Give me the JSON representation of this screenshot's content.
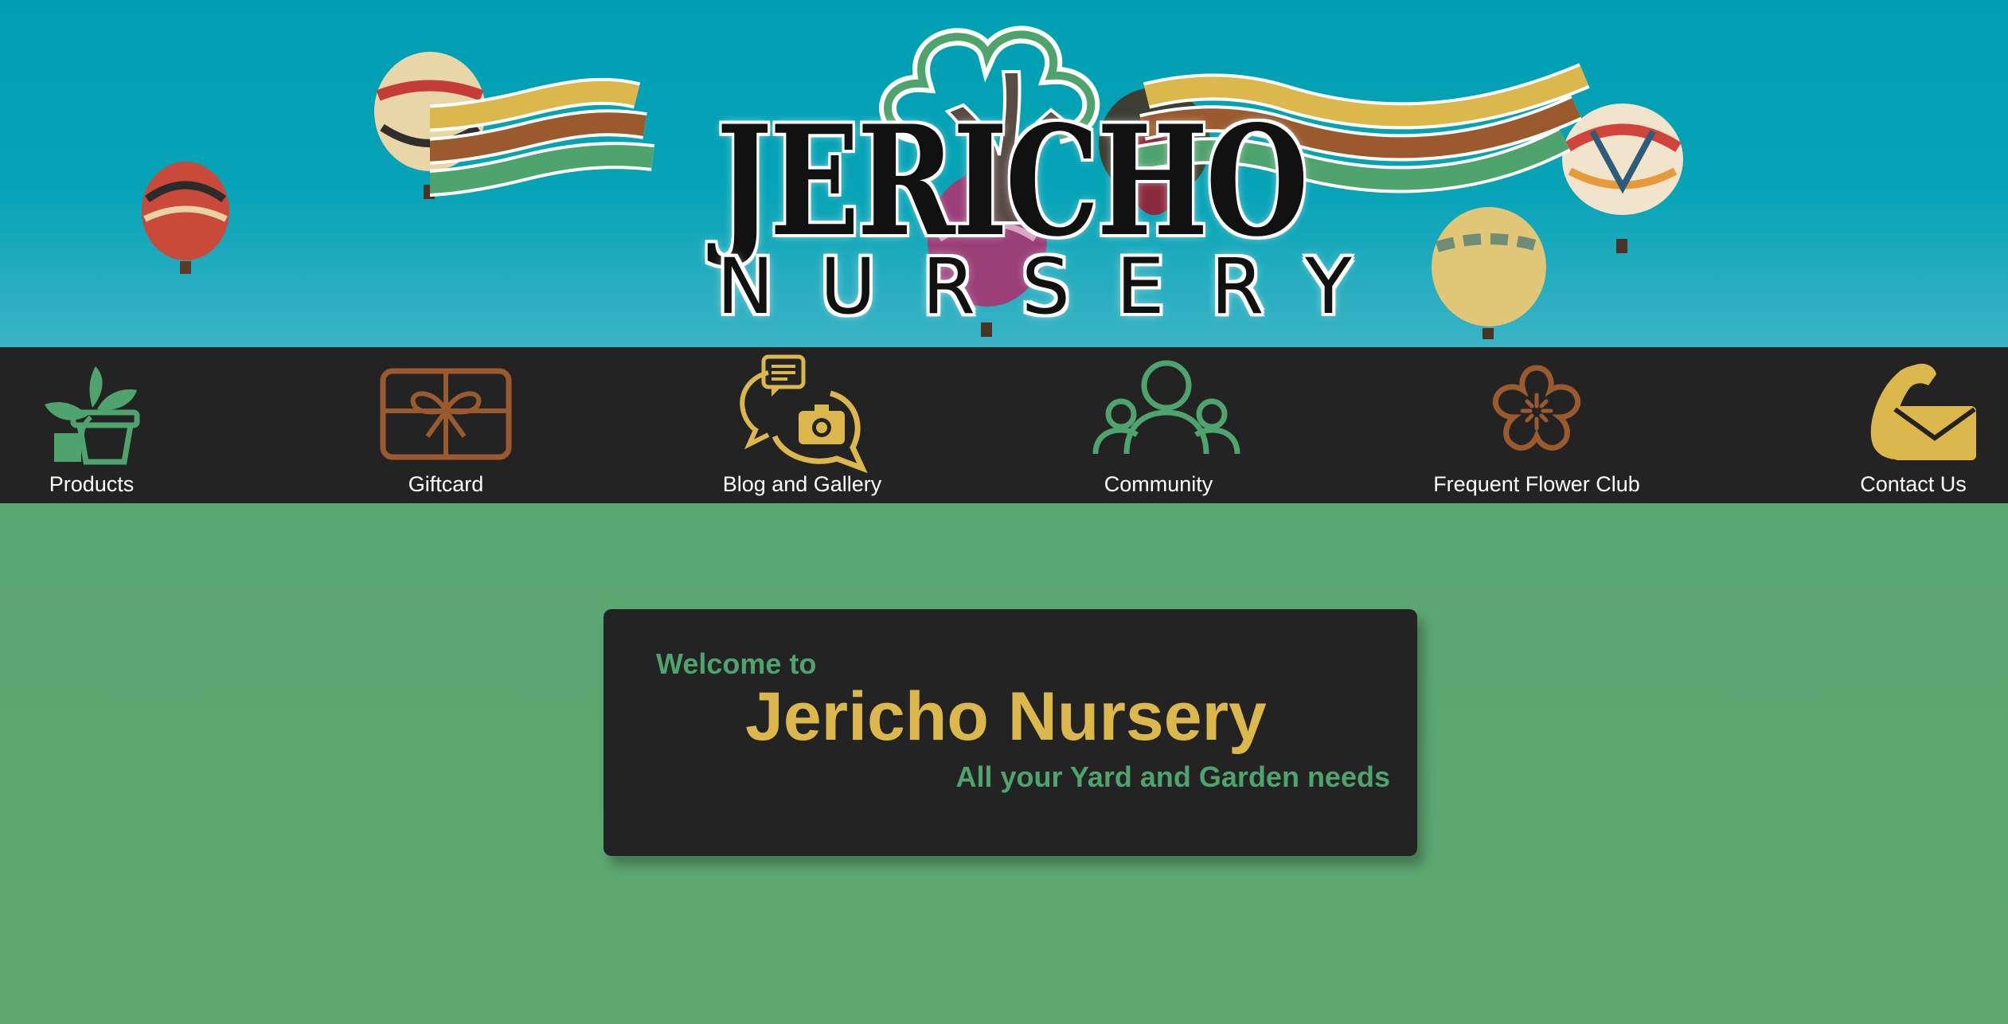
{
  "hero": {
    "logo_main": "JERICHO",
    "logo_sub": "NURSERY"
  },
  "nav": {
    "items": [
      {
        "label": "Products",
        "icon": "potted-plant-icon",
        "color": "#4fa36d"
      },
      {
        "label": "Giftcard",
        "icon": "gift-card-icon",
        "color": "#9a5a2e"
      },
      {
        "label": "Blog and Gallery",
        "icon": "chat-camera-icon",
        "color": "#dcb84c"
      },
      {
        "label": "Community",
        "icon": "people-group-icon",
        "color": "#4fa36d"
      },
      {
        "label": "Frequent Flower Club",
        "icon": "flower-icon",
        "color": "#9a5a2e"
      },
      {
        "label": "Contact Us",
        "icon": "phone-envelope-icon",
        "color": "#dcb84c"
      }
    ]
  },
  "welcome_card": {
    "welcome": "Welcome to",
    "title": "Jericho Nursery",
    "tagline": "All your Yard and Garden needs"
  },
  "colors": {
    "green": "#4fa36d",
    "gold": "#dcb84c",
    "brown": "#9a5a2e",
    "dark": "#232323",
    "sky": "#009fb2"
  }
}
